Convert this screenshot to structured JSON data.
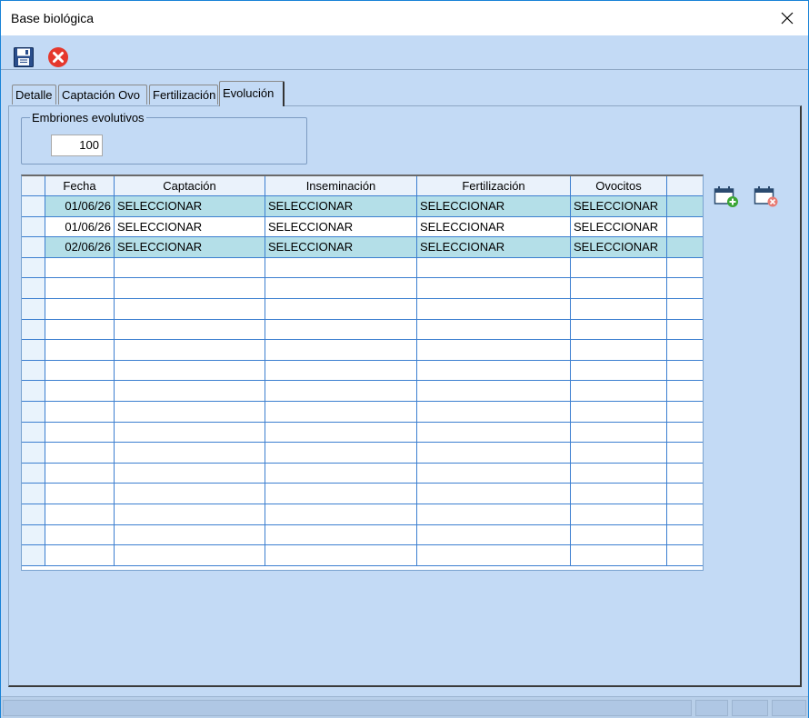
{
  "window": {
    "title": "Base biológica"
  },
  "toolbar": {
    "save_icon": "save-icon",
    "cancel_icon": "cancel-icon"
  },
  "tabs": [
    {
      "label": "Detalle"
    },
    {
      "label": "Captación Ovo"
    },
    {
      "label": "Fertilización"
    },
    {
      "label": "Evolución"
    }
  ],
  "embriones": {
    "label": "Embriones evolutivos",
    "value": "100"
  },
  "grid": {
    "columns": [
      "Fecha",
      "Captación",
      "Inseminación",
      "Fertilización",
      "Ovocitos"
    ],
    "rows": [
      {
        "fecha": "01/06/26",
        "captacion": "SELECCIONAR",
        "inseminacion": "SELECCIONAR",
        "fertilizacion": "SELECCIONAR",
        "ovocitos": "SELECCIONAR",
        "selected": true
      },
      {
        "fecha": "01/06/26",
        "captacion": "SELECCIONAR",
        "inseminacion": "SELECCIONAR",
        "fertilizacion": "SELECCIONAR",
        "ovocitos": "SELECCIONAR",
        "selected": false
      },
      {
        "fecha": "02/06/26",
        "captacion": "SELECCIONAR",
        "inseminacion": "SELECCIONAR",
        "fertilizacion": "SELECCIONAR",
        "ovocitos": "SELECCIONAR",
        "selected": true
      }
    ]
  },
  "colors": {
    "background": "#c3daf5",
    "grid_line": "#3c7fd0",
    "selected_row": "#b4dfe8",
    "cancel_red": "#e5382d"
  }
}
